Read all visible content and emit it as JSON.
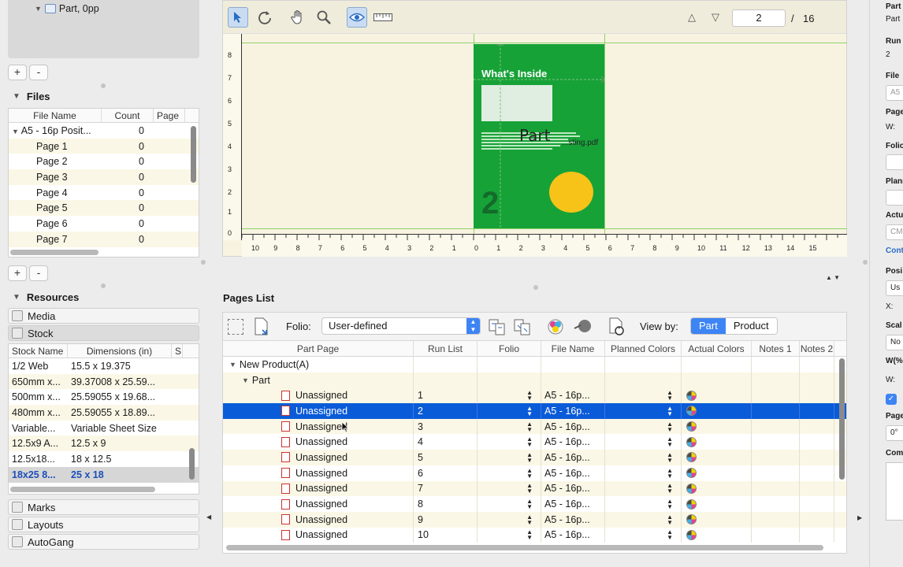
{
  "left_panel": {
    "tree_item": "Part, 0pp",
    "add_label": "+",
    "remove_label": "-",
    "files": {
      "title": "Files",
      "columns": [
        "File Name",
        "Count",
        "Page"
      ],
      "rows": [
        {
          "name": "A5 - 16p Posit...",
          "count": "0"
        },
        {
          "name": "Page 1",
          "count": "0"
        },
        {
          "name": "Page 2",
          "count": "0"
        },
        {
          "name": "Page 3",
          "count": "0"
        },
        {
          "name": "Page 4",
          "count": "0"
        },
        {
          "name": "Page 5",
          "count": "0"
        },
        {
          "name": "Page 6",
          "count": "0"
        },
        {
          "name": "Page 7",
          "count": "0"
        }
      ]
    },
    "resources": {
      "title": "Resources",
      "tabs": [
        "Media",
        "Stock"
      ],
      "columns": [
        "Stock Name",
        "Dimensions (in)",
        "S"
      ],
      "rows": [
        {
          "name": "1/2 Web",
          "dims": "15.5 x 19.375"
        },
        {
          "name": "650mm x...",
          "dims": "39.37008 x 25.59..."
        },
        {
          "name": "500mm x...",
          "dims": "25.59055 x 19.68..."
        },
        {
          "name": "480mm x...",
          "dims": "25.59055 x 18.89..."
        },
        {
          "name": "Variable...",
          "dims": "Variable Sheet Size"
        },
        {
          "name": "12.5x9 A...",
          "dims": "12.5 x 9"
        },
        {
          "name": "12.5x18...",
          "dims": "18 x 12.5"
        },
        {
          "name": "18x25 8...",
          "dims": "25 x 18"
        }
      ],
      "bottom_tabs": [
        "Marks",
        "Layouts",
        "AutoGang"
      ]
    }
  },
  "viewer": {
    "current_page": "2",
    "page_separator": "/",
    "total_pages": "16",
    "ruler_v": [
      "8",
      "7",
      "6",
      "5",
      "4",
      "3",
      "2",
      "1",
      "0"
    ],
    "ruler_h": [
      "10",
      "9",
      "8",
      "7",
      "6",
      "5",
      "4",
      "3",
      "2",
      "1",
      "0",
      "1",
      "2",
      "3",
      "4",
      "5",
      "6",
      "7",
      "8",
      "9",
      "10",
      "11",
      "12",
      "13",
      "14",
      "15"
    ],
    "page_content": {
      "title": "What's Inside",
      "number": "2",
      "part_label": "Part",
      "file_label": "...sting.pdf"
    }
  },
  "pages_list": {
    "title": "Pages List",
    "folio_label": "Folio:",
    "folio_value": "User-defined",
    "view_by_label": "View by:",
    "view_by_options": [
      "Part",
      "Product"
    ],
    "columns": [
      "Part Page",
      "Run List",
      "Folio",
      "File Name",
      "Planned Colors",
      "Actual Colors",
      "Notes 1",
      "Notes 2"
    ],
    "product": "New Product(A)",
    "part": "Part",
    "rows": [
      {
        "page": "Unassigned",
        "run": "1",
        "file": "A5 - 16p..."
      },
      {
        "page": "Unassigned",
        "run": "2",
        "file": "A5 - 16p..."
      },
      {
        "page": "Unassigned",
        "run": "3",
        "file": "A5 - 16p..."
      },
      {
        "page": "Unassigned",
        "run": "4",
        "file": "A5 - 16p..."
      },
      {
        "page": "Unassigned",
        "run": "5",
        "file": "A5 - 16p..."
      },
      {
        "page": "Unassigned",
        "run": "6",
        "file": "A5 - 16p..."
      },
      {
        "page": "Unassigned",
        "run": "7",
        "file": "A5 - 16p..."
      },
      {
        "page": "Unassigned",
        "run": "8",
        "file": "A5 - 16p..."
      },
      {
        "page": "Unassigned",
        "run": "9",
        "file": "A5 - 16p..."
      },
      {
        "page": "Unassigned",
        "run": "10",
        "file": "A5 - 16p..."
      }
    ],
    "selected_run": "2"
  },
  "right_panel": {
    "part_title": "Part",
    "part_value": "Part",
    "run_label": "Run",
    "run_value": "2",
    "file_label": "File",
    "file_value": "A5",
    "page_label": "Page",
    "w_label": "W:",
    "folio_label": "Folio",
    "planned_label": "Plann",
    "actual_label": "Actu",
    "cm_value": "CM",
    "cont_label": "Cont",
    "position_label": "Posi",
    "position_value": "Us",
    "x_label": "X:",
    "scale_label": "Scal",
    "scale_value": "No",
    "w_percent_label": "W(%",
    "w2_label": "W:",
    "page_rot_label": "Page",
    "rot_value": "0°",
    "comments_label": "Com"
  }
}
